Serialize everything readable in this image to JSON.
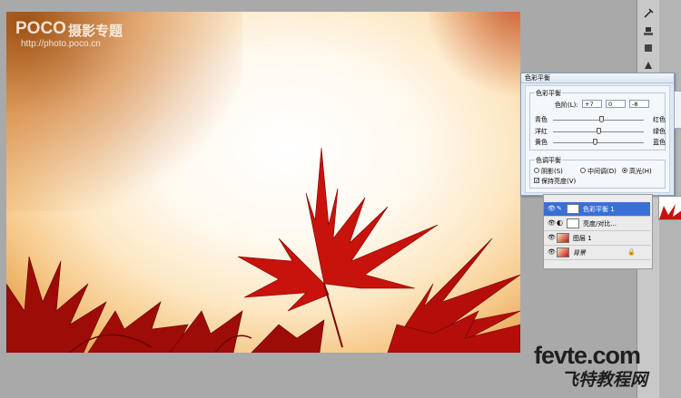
{
  "watermark": {
    "brand": "POCO",
    "brand_cn": "摄影专题",
    "url": "http://photo.poco.cn"
  },
  "dialog": {
    "title": "色彩平衡",
    "color_balance_group": "色彩平衡",
    "levels_label": "色阶(L):",
    "levels": [
      "+7",
      "0",
      "-8"
    ],
    "sliders": [
      {
        "left": "青色",
        "right": "红色",
        "value": 7
      },
      {
        "left": "洋红",
        "right": "绿色",
        "value": 0
      },
      {
        "left": "黄色",
        "right": "蓝色",
        "value": -8
      }
    ],
    "tone_group": "色调平衡",
    "tones": [
      {
        "label": "阴影(S)",
        "selected": false
      },
      {
        "label": "中间调(D)",
        "selected": false
      },
      {
        "label": "高光(H)",
        "selected": true
      }
    ],
    "preserve_luminosity": {
      "label": "保持亮度(V)",
      "checked": true
    }
  },
  "layers": [
    {
      "name": "色彩平衡 1",
      "selected": true,
      "type": "adjustment"
    },
    {
      "name": "亮度/对比...",
      "selected": false,
      "type": "adjustment"
    },
    {
      "name": "图层 1",
      "selected": false,
      "type": "image"
    },
    {
      "name": "背景",
      "selected": false,
      "type": "image",
      "locked": true
    }
  ],
  "site_logo": {
    "line1": "fevte.com",
    "line2": "飞特教程网"
  },
  "colors": {
    "leaf": "#c8120c",
    "selection": "#3a6fd8",
    "dialog_bg": "#dfe9f5"
  }
}
